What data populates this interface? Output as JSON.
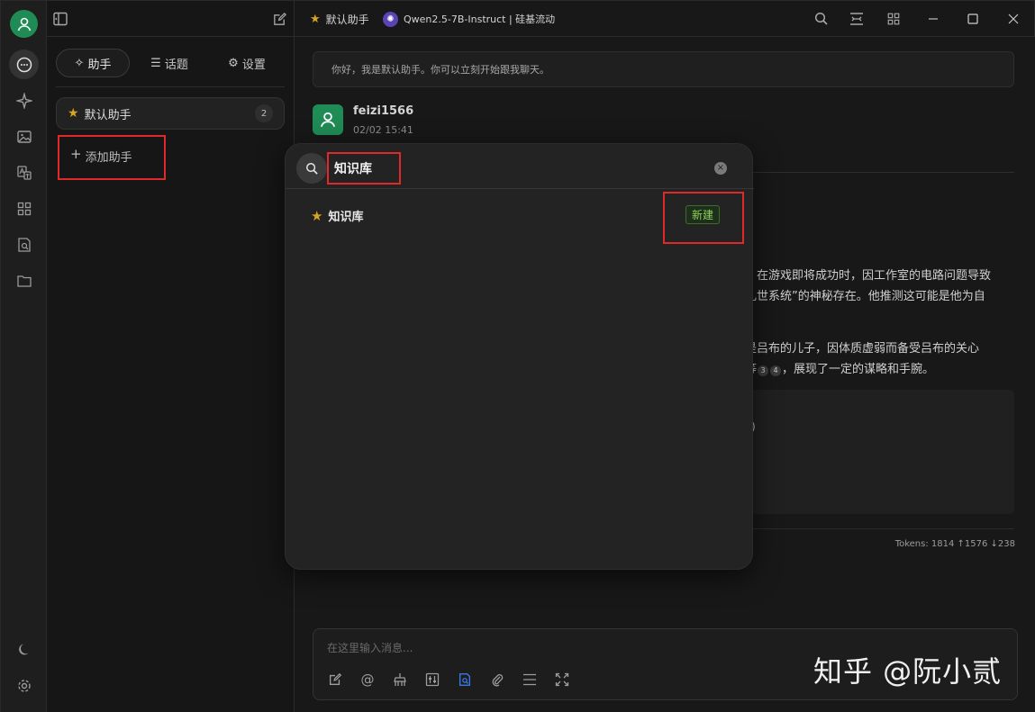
{
  "topbar": {
    "assistant_name": "默认助手",
    "model_name": "Qwen2.5-7B-Instruct | 硅基流动"
  },
  "sidebar": {
    "tabs": [
      {
        "label": "助手"
      },
      {
        "label": "话题"
      },
      {
        "label": "设置"
      }
    ],
    "assistant": {
      "name": "默认助手",
      "count": "2"
    },
    "add_assistant_label": "添加助手"
  },
  "chat": {
    "welcome": "你好，我是默认助手。你可以立刻开始跟我聊天。",
    "user_name": "feizi1566",
    "timestamp": "02/02 15:41",
    "para1_line1": "，在游戏即将成功时，因工作室的电路问题导致",
    "para1_line2": "乱世系统”的神秘存在。他推测这可能是他为自",
    "para2_line1": "是吕布的儿子，因体质虚弱而备受吕布的关心",
    "para2_line2_pre": "等",
    "cite1": "3",
    "cite2": "4",
    "para2_line2_post": "，展现了一定的谋略和手腕。",
    "code_fragment": ")",
    "tokens": "Tokens: 1814 ↑1576 ↓238",
    "input_placeholder": "在这里输入消息..."
  },
  "modal": {
    "query": "知识库",
    "result_label": "知识库",
    "new_tag": "新建"
  },
  "watermark": "知乎 @阮小贰",
  "colors": {
    "accent_green": "#1f8b55",
    "highlight_red": "#e02a2a",
    "tag_green": "#8bd35a",
    "star_gold": "#d9a520"
  }
}
